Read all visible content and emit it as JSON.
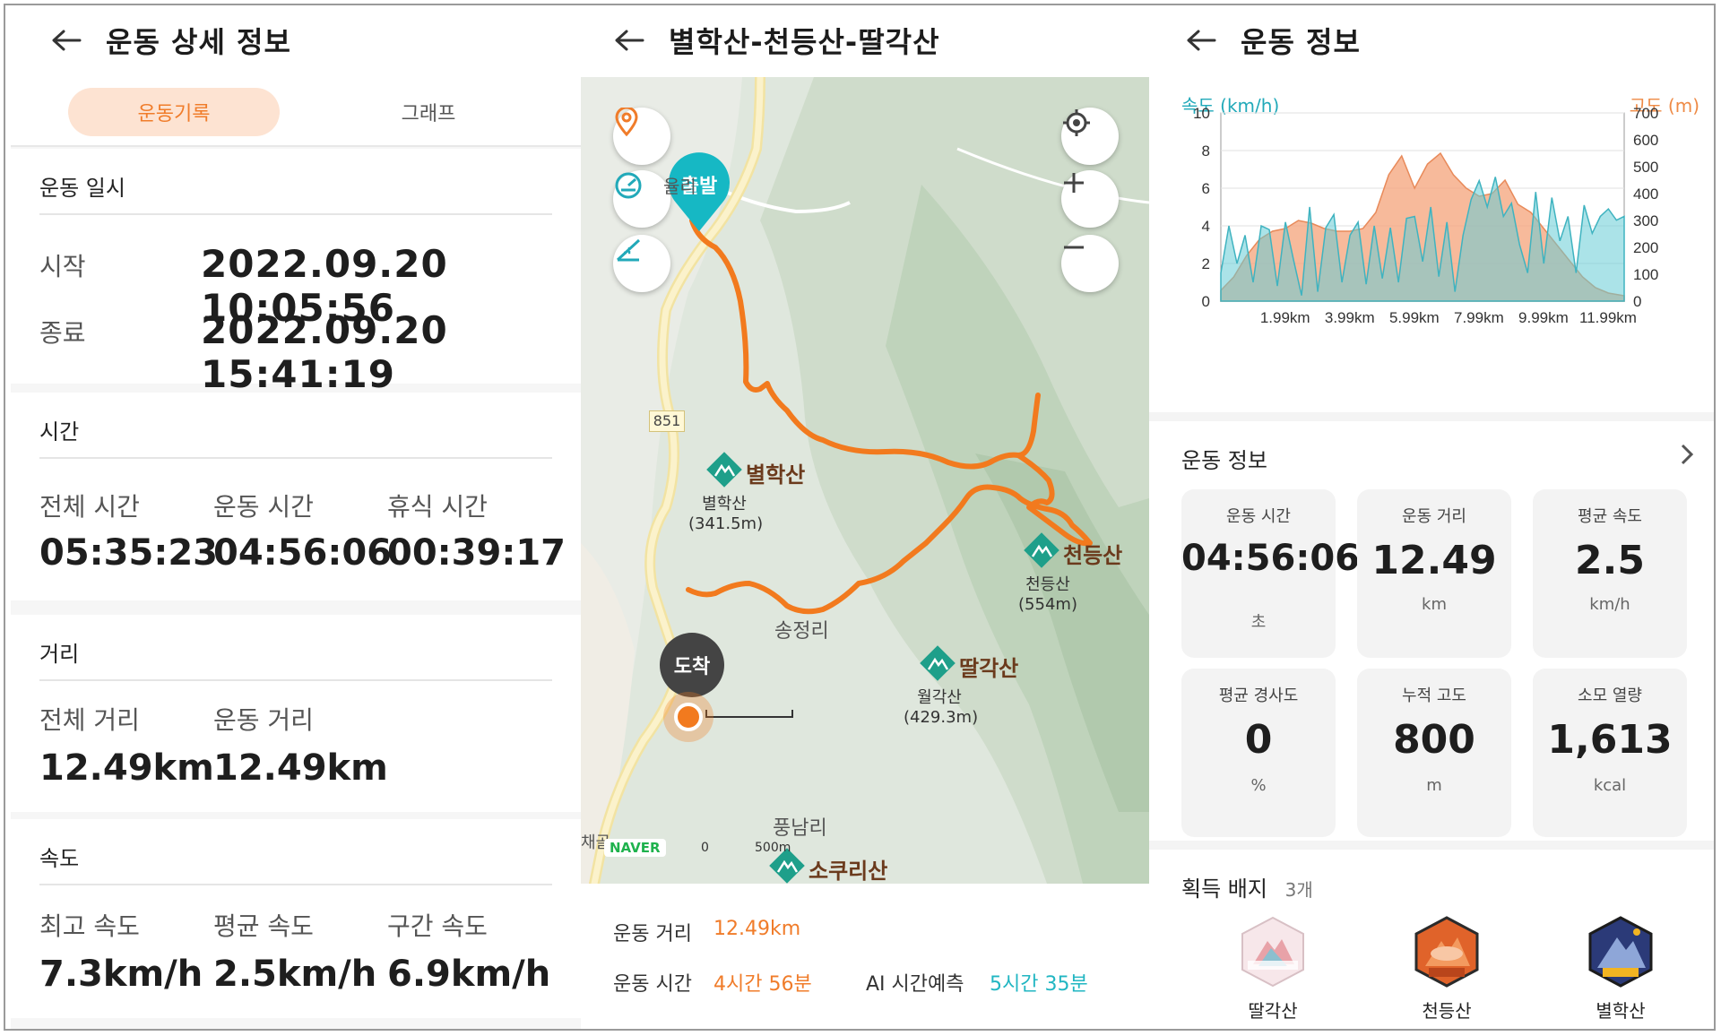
{
  "left_panel": {
    "title": "운동 상세 정보",
    "tabs": [
      "운동기록",
      "그래프"
    ],
    "datetime": {
      "section": "운동 일시",
      "start_label": "시작",
      "start_value": "2022.09.20 10:05:56",
      "end_label": "종료",
      "end_value": "2022.09.20 15:41:19"
    },
    "time": {
      "section": "시간",
      "items": [
        {
          "label": "전체 시간",
          "value": "05:35:23"
        },
        {
          "label": "운동 시간",
          "value": "04:56:06"
        },
        {
          "label": "휴식 시간",
          "value": "00:39:17"
        }
      ]
    },
    "distance": {
      "section": "거리",
      "items": [
        {
          "label": "전체 거리",
          "value": "12.49km"
        },
        {
          "label": "운동 거리",
          "value": "12.49km"
        }
      ]
    },
    "speed": {
      "section": "속도",
      "items": [
        {
          "label": "최고 속도",
          "value": "7.3km/h"
        },
        {
          "label": "평균 속도",
          "value": "2.5km/h"
        },
        {
          "label": "구간 속도",
          "value": "6.9km/h"
        }
      ]
    }
  },
  "middle_panel": {
    "title": "별학산-천등산-딸각산",
    "map": {
      "start_pin": "출발",
      "end_pin": "도착",
      "road_number": "851",
      "peaks": [
        {
          "name": "별학산",
          "sub1": "별학산",
          "sub2": "(341.5m)"
        },
        {
          "name": "천등산",
          "sub1": "천등산",
          "sub2": "(554m)"
        },
        {
          "name": "딸각산",
          "sub1": "월각산",
          "sub2": "(429.3m)"
        },
        {
          "name": "소쿠리산"
        }
      ],
      "places": [
        "송정리",
        "풍남리",
        "율리",
        "채골"
      ],
      "naver": "NAVER",
      "scale": {
        "zero": "0",
        "dist": "500m"
      }
    },
    "route_info": {
      "distance_label": "운동 거리",
      "distance_value": "12.49km",
      "time_label": "운동 시간",
      "time_value": "4시간 56분",
      "ai_label": "AI 시간예측",
      "ai_value": "5시간 35분"
    }
  },
  "right_panel": {
    "title": "운동 정보",
    "chart_data": {
      "type": "area",
      "left_axis_title": "속도 (km/h)",
      "right_axis_title": "고도 (m)",
      "left_ticks": [
        "10",
        "8",
        "6",
        "4",
        "2",
        "0"
      ],
      "right_ticks": [
        "700",
        "600",
        "500",
        "400",
        "300",
        "200",
        "100",
        "0"
      ],
      "x_ticks": [
        "1.99km",
        "3.99km",
        "5.99km",
        "7.99km",
        "9.99km",
        "11.99km"
      ],
      "ylim_left": [
        0,
        10
      ],
      "ylim_right": [
        0,
        700
      ],
      "xlim": [
        0,
        12.49
      ],
      "series": [
        {
          "name": "고도 (m)",
          "axis": "right",
          "color": "#f4a37a",
          "x": [
            0,
            0.4,
            0.8,
            1.2,
            1.6,
            2.0,
            2.4,
            2.8,
            3.2,
            3.6,
            4.0,
            4.4,
            4.8,
            5.2,
            5.6,
            6.0,
            6.4,
            6.8,
            7.2,
            7.6,
            8.0,
            8.4,
            8.8,
            9.2,
            9.6,
            10.0,
            10.4,
            10.8,
            11.2,
            11.6,
            12.0,
            12.49
          ],
          "y": [
            40,
            90,
            170,
            230,
            260,
            270,
            300,
            290,
            270,
            260,
            260,
            270,
            330,
            470,
            540,
            420,
            510,
            550,
            470,
            420,
            390,
            400,
            450,
            360,
            330,
            270,
            210,
            150,
            90,
            50,
            30,
            20
          ]
        },
        {
          "name": "속도 (km/h)",
          "axis": "left",
          "color": "#66ccd6",
          "x": [
            0,
            0.25,
            0.5,
            0.75,
            1.0,
            1.25,
            1.5,
            1.75,
            2.0,
            2.25,
            2.5,
            2.75,
            3.0,
            3.25,
            3.5,
            3.75,
            4.0,
            4.25,
            4.5,
            4.75,
            5.0,
            5.25,
            5.5,
            5.75,
            6.0,
            6.25,
            6.5,
            6.75,
            7.0,
            7.25,
            7.5,
            7.75,
            8.0,
            8.25,
            8.5,
            8.75,
            9.0,
            9.25,
            9.5,
            9.75,
            10.0,
            10.25,
            10.5,
            10.75,
            11.0,
            11.25,
            11.5,
            11.75,
            12.0,
            12.25,
            12.49
          ],
          "y": [
            1.5,
            4.0,
            2.0,
            3.5,
            1.0,
            4.0,
            3.8,
            0.8,
            4.2,
            2.2,
            0.3,
            5.0,
            0.5,
            3.9,
            4.6,
            1.0,
            3.5,
            4.2,
            0.9,
            4.0,
            1.2,
            3.9,
            1.0,
            4.4,
            4.5,
            2.1,
            5.0,
            1.3,
            4.2,
            0.5,
            3.5,
            5.4,
            6.4,
            5.0,
            6.6,
            4.5,
            5.2,
            3.0,
            1.5,
            5.8,
            2.0,
            5.5,
            3.2,
            4.5,
            1.5,
            5.1,
            3.6,
            4.5,
            4.9,
            4.3,
            4.5
          ]
        }
      ]
    },
    "info": {
      "section": "운동 정보",
      "tiles": [
        {
          "label": "운동 시간",
          "value": "04:56:06",
          "unit": "초"
        },
        {
          "label": "운동 거리",
          "value": "12.49",
          "unit": "km"
        },
        {
          "label": "평균 속도",
          "value": "2.5",
          "unit": "km/h"
        },
        {
          "label": "평균 경사도",
          "value": "0",
          "unit": "%"
        },
        {
          "label": "누적 고도",
          "value": "800",
          "unit": "m"
        },
        {
          "label": "소모 열량",
          "value": "1,613",
          "unit": "kcal"
        }
      ]
    },
    "badges": {
      "section": "획득 배지",
      "count": "3개",
      "items": [
        {
          "name": "딸각산",
          "logo": "TRANGGLE MOUNTAIN PEAK",
          "color": "#e8a2a8"
        },
        {
          "name": "천등산",
          "logo": "PEAK",
          "color": "#e0632a"
        },
        {
          "name": "별학산",
          "logo": "PEAK",
          "color": "#f2b422"
        }
      ]
    }
  },
  "colors": {
    "accent_orange": "#f07c2a",
    "accent_teal": "#21b6c2",
    "route": "#f27a1e",
    "pin": "#16b8c4"
  }
}
